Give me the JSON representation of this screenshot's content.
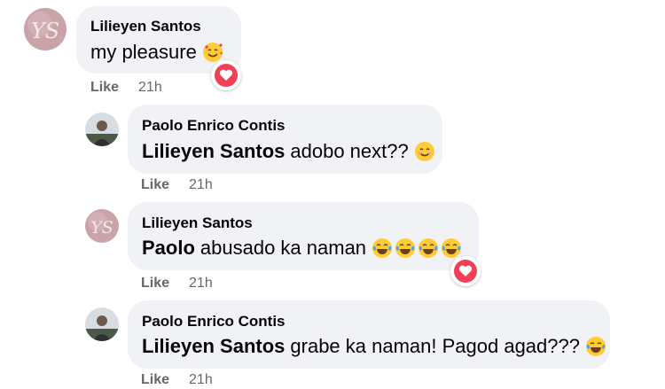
{
  "comments": [
    {
      "author": "Lilieyen Santos",
      "mention": "",
      "text": "my pleasure",
      "emoji": [
        "smiling-face-with-hearts"
      ],
      "like_label": "Like",
      "time": "21h",
      "reaction": "love"
    },
    {
      "author": "Paolo Enrico Contis",
      "mention": "Lilieyen Santos",
      "text": "adobo next??",
      "emoji": [
        "smiling-face-with-smiling-eyes"
      ],
      "like_label": "Like",
      "time": "21h",
      "reaction": ""
    },
    {
      "author": "Lilieyen Santos",
      "mention": "Paolo",
      "text": "abusado ka naman",
      "emoji": [
        "tears-of-joy",
        "tears-of-joy",
        "tears-of-joy",
        "tears-of-joy"
      ],
      "like_label": "Like",
      "time": "21h",
      "reaction": "love"
    },
    {
      "author": "Paolo Enrico Contis",
      "mention": "Lilieyen Santos",
      "text": "grabe ka naman! Pagod agad???",
      "emoji": [
        "tears-of-joy"
      ],
      "like_label": "Like",
      "time": "21h",
      "reaction": ""
    }
  ],
  "colors": {
    "bubble": "#f0f2f5",
    "meta_text": "#65676b",
    "love_reaction": "#f33e58",
    "avatar_ys_bg": "#c9a3a8",
    "avatar_ys_letters": "#f4e7ea"
  },
  "avatar_ys_initials": "YS"
}
